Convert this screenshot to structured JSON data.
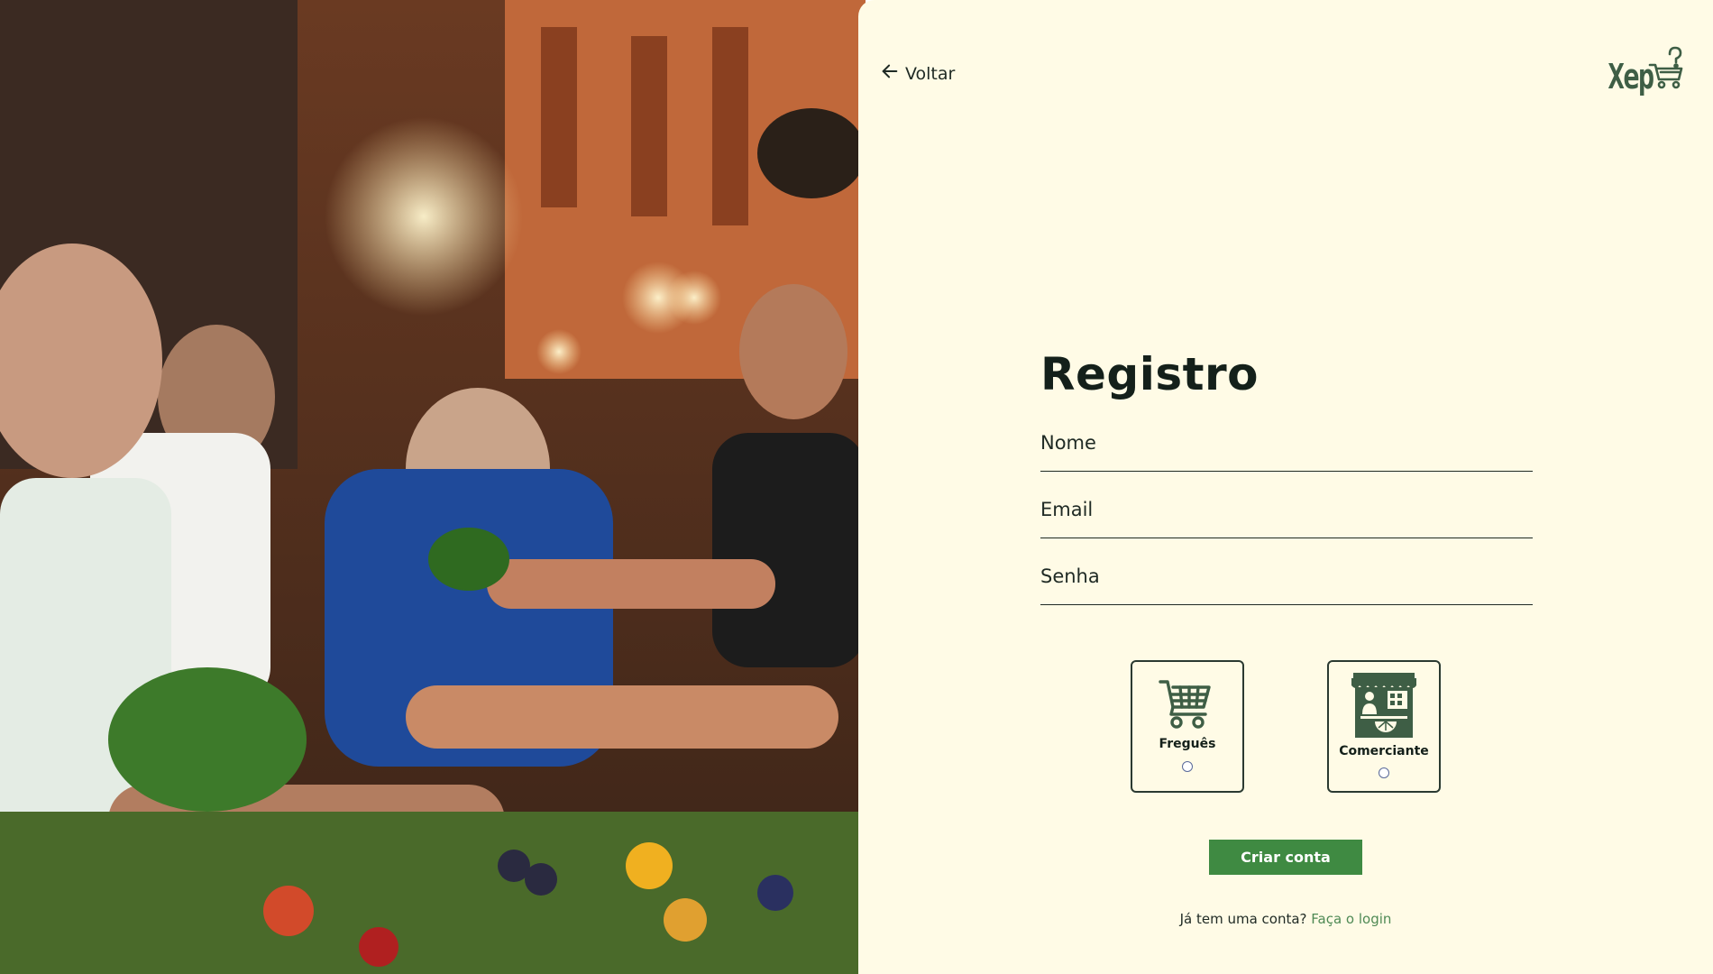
{
  "nav": {
    "back_label": "Voltar"
  },
  "brand": {
    "logo_text": "Xep",
    "accent_color": "#3e5e45"
  },
  "form": {
    "title": "Registro",
    "fields": {
      "name_placeholder": "Nome",
      "email_placeholder": "Email",
      "password_placeholder": "Senha"
    },
    "roles": [
      {
        "label": "Freguês",
        "icon": "shopping-cart-icon",
        "selected": false
      },
      {
        "label": "Comerciante",
        "icon": "market-stall-icon",
        "selected": false
      }
    ],
    "submit_label": "Criar conta",
    "submit_color": "#3f8a42",
    "login_prompt": "Já tem uma conta?",
    "login_link": "Faça o login"
  },
  "colors": {
    "panel_background": "#fffbe6",
    "text_dark": "#14201a",
    "link_green": "#4f8a55"
  },
  "hero_image": {
    "icon": "market-photo"
  }
}
